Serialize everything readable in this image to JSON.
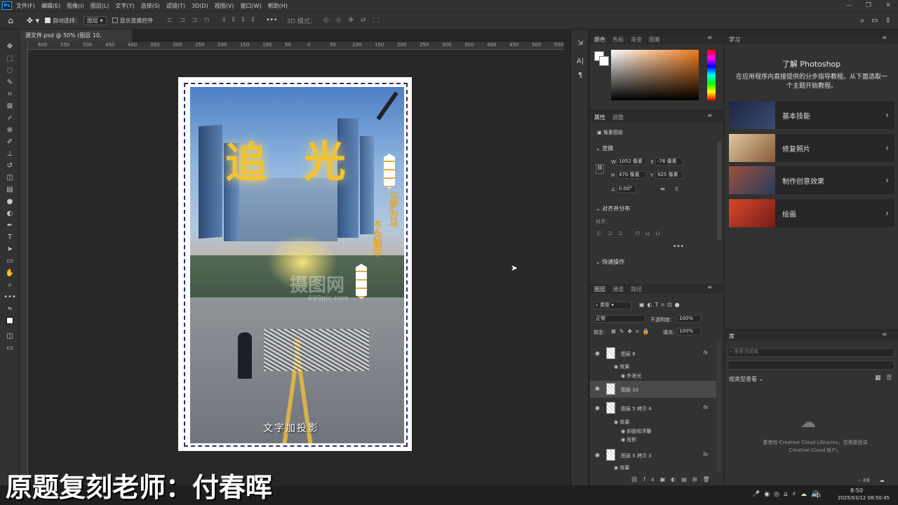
{
  "menubar": {
    "logo": "Ps",
    "items": [
      "文件(F)",
      "编辑(E)",
      "图像(I)",
      "图层(L)",
      "文字(Y)",
      "选择(S)",
      "滤镜(T)",
      "3D(D)",
      "视图(V)",
      "窗口(W)",
      "帮助(H)"
    ],
    "window_buttons": [
      "—",
      "❐",
      "✕"
    ]
  },
  "options": {
    "auto_select_label": "自动选择：",
    "auto_select_value": "图层",
    "show_transform_label": "显示变换控件",
    "mode_3d_label": "3D 模式："
  },
  "document_tab": {
    "title": "源文件.psd @ 50% (图层 10, RGB/8#) *",
    "close": "×"
  },
  "ruler_ticks": [
    "600",
    "550",
    "500",
    "450",
    "400",
    "350",
    "300",
    "250",
    "200",
    "150",
    "100",
    "50",
    "0",
    "50",
    "100",
    "150",
    "200",
    "250",
    "300",
    "350",
    "400",
    "450",
    "500",
    "550",
    "600",
    "650",
    "700",
    "750",
    "800",
    "850",
    "900",
    "950",
    "1000",
    "1050",
    "1100",
    "1150",
    "1200",
    "1250",
    "1300",
    "1350",
    "1400",
    "1450",
    "1500",
    "1550",
    "1600"
  ],
  "artwork": {
    "title_chars": [
      "追",
      "光"
    ],
    "side_text_1": "以梦为马",
    "side_text_2": "不负韶华",
    "watermark": "摄图网",
    "watermark_url": "699pic.com",
    "caption": "文字加投影"
  },
  "color_panel": {
    "tabs": [
      "颜色",
      "色板",
      "渐变",
      "图案"
    ]
  },
  "properties_panel": {
    "tabs": [
      "属性",
      "调整"
    ],
    "layer_type": "像素图层",
    "transform_label": "变换",
    "w_label": "W",
    "w_value": "1052 像素",
    "x_label": "X",
    "x_value": "-76 像素",
    "h_label": "H",
    "h_value": "470 像素",
    "y_label": "Y",
    "y_value": "925 像素",
    "angle_value": "0.00°",
    "align_label": "对齐并分布",
    "align_sub": "对齐：",
    "quick_actions": "快速操作"
  },
  "layers_panel": {
    "tabs": [
      "图层",
      "通道",
      "路径"
    ],
    "filter_kind": "类型",
    "blend_mode": "正常",
    "opacity_label": "不透明度:",
    "opacity_value": "100%",
    "lock_label": "锁定:",
    "fill_label": "填充:",
    "fill_value": "100%",
    "layers": [
      {
        "name": "图层 6",
        "fx": "fx",
        "effects_label": "效果",
        "effects": [
          "外发光"
        ]
      },
      {
        "name": "图层 10",
        "selected": true
      },
      {
        "name": "图层 5 拷贝 4",
        "fx": "fx",
        "effects_label": "效果",
        "effects": [
          "斜面和浮雕",
          "投影"
        ]
      },
      {
        "name": "图层 5 拷贝 3",
        "fx": "fx",
        "effects_label": "效果"
      }
    ]
  },
  "learn_panel": {
    "tab": "学习",
    "title": "了解 Photoshop",
    "subtitle": "在应用程序内直接提供的分步指导教程。从下面选取一个主题开始教程。",
    "cards": [
      {
        "label": "基本技能",
        "color": "#2a3550"
      },
      {
        "label": "修复照片",
        "color": "#b5895a"
      },
      {
        "label": "制作创意效果",
        "color": "#7a4a3a"
      },
      {
        "label": "绘画",
        "color": "#c0392b"
      }
    ]
  },
  "libraries_panel": {
    "tab": "库",
    "search_placeholder": "搜索当前库",
    "view_label": "按类型查看",
    "message": "要使用 Creative Cloud Libraries，您需要登录 Creative Cloud 帐户。",
    "size": "-- KB"
  },
  "taskbar": {
    "time": "8:50",
    "date": "2025/03/12 08:50:45",
    "ime": "中"
  },
  "overlay_caption": "原题复刻老师：付春晖"
}
